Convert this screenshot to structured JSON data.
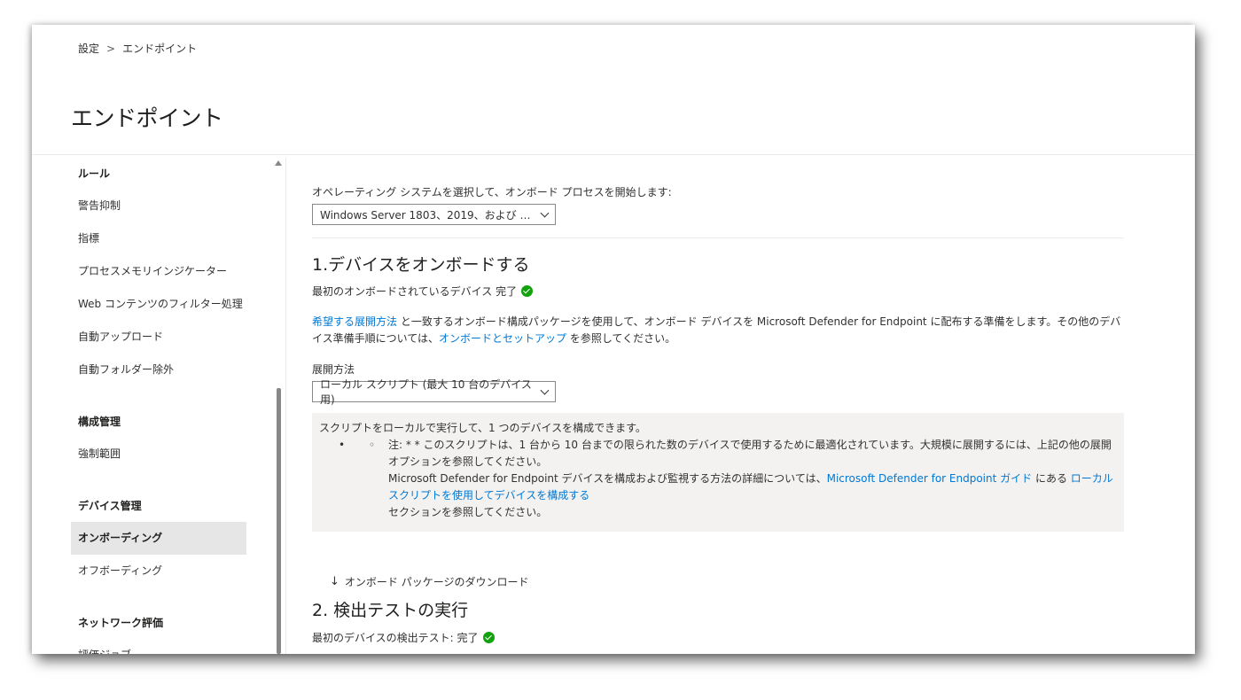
{
  "breadcrumb": {
    "root": "設定",
    "separator": ">",
    "current": "エンドポイント"
  },
  "page_title": "エンドポイント",
  "sidebar": {
    "groups": [
      {
        "section": "ルール",
        "items": [
          "警告抑制",
          "指標",
          "プロセスメモリインジケーター",
          "Web コンテンツのフィルター処理",
          "自動アップロード",
          "自動フォルダー除外"
        ]
      },
      {
        "section": "構成管理",
        "items": [
          "強制範囲"
        ]
      },
      {
        "section": "デバイス管理",
        "items": [
          "オンボーディング",
          "オフボーディング"
        ],
        "active": "オンボーディング"
      },
      {
        "section": "ネットワーク評価",
        "items": [
          "評価ジョブ"
        ]
      }
    ]
  },
  "content": {
    "os_label": "オペレーティング システムを選択して、オンボード プロセスを開始します:",
    "os_selected": "Windows Server 1803、2019、および …",
    "step1_title": "1.デバイスをオンボードする",
    "step1_status": "最初のオンボードされているデバイス 完了",
    "desc_link1": "希望する展開方法",
    "desc_text1": " と一致するオンボード構成パッケージを使用して、オンボード デバイスを Microsoft Defender for Endpoint に配布する準備をします。その他のデバイス準備手順については、",
    "desc_link2": "オンボードとセットアップ",
    "desc_text2": " を参照してください。",
    "deploy_label": "展開方法",
    "deploy_selected": "ローカル スクリプト (最大 10 台のデバイス用)",
    "notice_line1": "スクリプトをローカルで実行して、1 つのデバイスを構成できます。",
    "notice_bullet": "•",
    "notice_circle": "◦",
    "notice_note": "注: * * このスクリプトは、1 台から 10 台までの限られた数のデバイスで使用するために最適化されています。大規模に展開するには、上記の他の展開オプションを参照してください。",
    "notice_more_text1": "Microsoft Defender for Endpoint デバイスを構成および監視する方法の詳細については、",
    "notice_more_link1": "Microsoft Defender for Endpoint ガイド",
    "notice_more_text2": " にある ",
    "notice_more_link2": "ローカル スクリプトを使用してデバイスを構成する",
    "notice_more_text3": "セクションを参照してください。",
    "download_label": "オンボード パッケージのダウンロード",
    "step2_title": "2. 検出テストの実行",
    "step2_status": "最初のデバイスの検出テスト: 完了"
  },
  "colors": {
    "link": "#0078d4",
    "success": "#13a10e",
    "active_nav": "#e6e6e6",
    "notice_bg": "#f3f2f1"
  }
}
